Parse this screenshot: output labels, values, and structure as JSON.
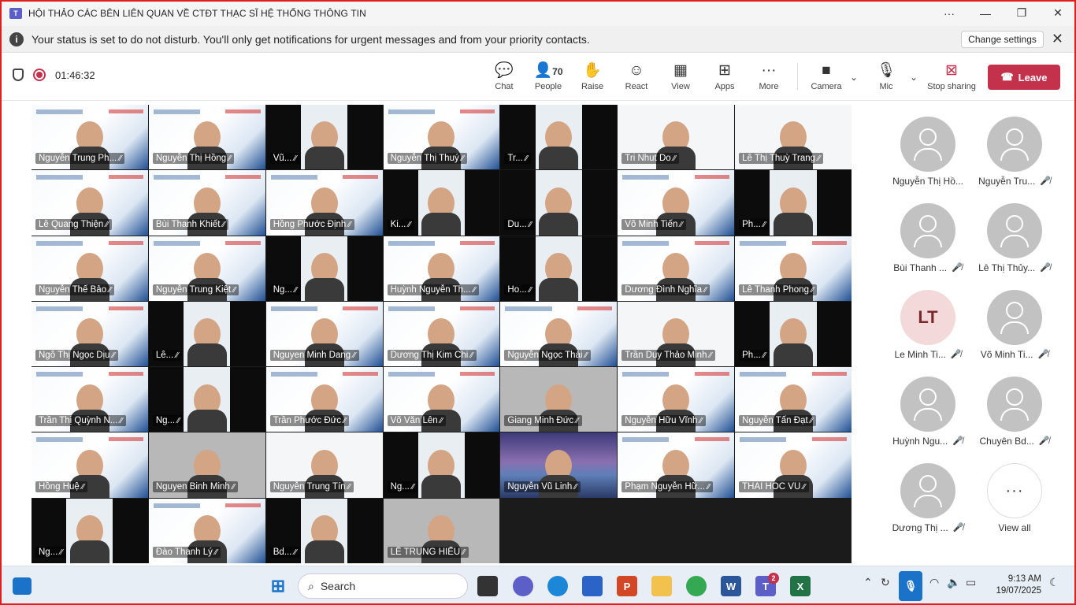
{
  "window": {
    "title": "HỘI THẢO CÁC BÊN LIÊN QUAN VỀ CTĐT THẠC SĨ HỆ THỐNG THÔNG TIN",
    "more_label": "···"
  },
  "banner": {
    "message": "Your status is set to do not disturb. You'll only get notifications for urgent messages and from your priority contacts.",
    "change_button": "Change settings"
  },
  "toolbar": {
    "timer": "01:46:32",
    "chat": "Chat",
    "people": "People",
    "people_count": "70",
    "raise": "Raise",
    "react": "React",
    "view": "View",
    "apps": "Apps",
    "more": "More",
    "camera": "Camera",
    "mic": "Mic",
    "stop_sharing": "Stop sharing",
    "leave": "Leave",
    "leave_color": "#c4314b"
  },
  "tiles": [
    {
      "name": "Nguyễn Trung  Ph...",
      "kind": "slide"
    },
    {
      "name": "Nguyễn Thị Hồng",
      "kind": "slide"
    },
    {
      "name": "Vũ...",
      "kind": "dark"
    },
    {
      "name": "Nguyễn Thị Thuý",
      "kind": "slide"
    },
    {
      "name": "Tr...",
      "kind": "dark"
    },
    {
      "name": "Tri Nhut Do",
      "kind": "light"
    },
    {
      "name": "Lê Thị Thuỳ Trang",
      "kind": "light"
    },
    {
      "name": "Lê Quang Thiện",
      "kind": "slide"
    },
    {
      "name": "Bùi Thanh Khiết",
      "kind": "slide"
    },
    {
      "name": "Hồng Phước Định",
      "kind": "slide"
    },
    {
      "name": "Ki...",
      "kind": "dark"
    },
    {
      "name": "Du...",
      "kind": "dark"
    },
    {
      "name": "Võ Minh Tiến",
      "kind": "slide"
    },
    {
      "name": "Ph...",
      "kind": "dark"
    },
    {
      "name": "Nguyễn Thế Bảo",
      "kind": "slide"
    },
    {
      "name": "Nguyễn Trung Kiệt",
      "kind": "slide"
    },
    {
      "name": "Ng...",
      "kind": "dark"
    },
    {
      "name": "Huỳnh Nguyễn Th...",
      "kind": "slide"
    },
    {
      "name": "Ho...",
      "kind": "dark"
    },
    {
      "name": "Dương Đình Nghĩa",
      "kind": "slide"
    },
    {
      "name": "Lê Thanh Phong",
      "kind": "slide"
    },
    {
      "name": "Ngô Thị Ngọc Dịu",
      "kind": "slide"
    },
    {
      "name": "Lê...",
      "kind": "dark"
    },
    {
      "name": "Nguyen Minh Dang",
      "kind": "slide"
    },
    {
      "name": "Dương Thị Kim Chi",
      "kind": "slide"
    },
    {
      "name": "Nguyễn Ngọc Thái",
      "kind": "slide"
    },
    {
      "name": "Trần Duy Thảo Minh",
      "kind": "light"
    },
    {
      "name": "Ph...",
      "kind": "dark"
    },
    {
      "name": "Trần Thị Quỳnh N...",
      "kind": "slide"
    },
    {
      "name": "Ng...",
      "kind": "dark"
    },
    {
      "name": "Trần Phước Đức",
      "kind": "slide"
    },
    {
      "name": "Võ Văn Lên",
      "kind": "slide"
    },
    {
      "name": "Giang Minh Đức",
      "kind": "gray"
    },
    {
      "name": "Nguyễn Hữu Vĩnh",
      "kind": "slide"
    },
    {
      "name": "Nguyễn Tấn Đạt",
      "kind": "slide"
    },
    {
      "name": "Hồng Huệ",
      "kind": "slide"
    },
    {
      "name": "Nguyen Binh Minh",
      "kind": "gray"
    },
    {
      "name": "Nguyễn Trung Tín",
      "kind": "light"
    },
    {
      "name": "Ng...",
      "kind": "dark"
    },
    {
      "name": "Nguyễn Vũ Linh",
      "kind": "mtn"
    },
    {
      "name": "Phạm Nguyễn Hữ...",
      "kind": "slide"
    },
    {
      "name": "THAI HOC VU",
      "kind": "slide"
    },
    {
      "name": "Ng...",
      "kind": "dark"
    },
    {
      "name": "Đào Thanh Lý",
      "kind": "slide"
    },
    {
      "name": "Bd...",
      "kind": "dark"
    },
    {
      "name": "LÊ TRUNG HIẾU",
      "kind": "gray"
    }
  ],
  "roster": [
    {
      "name": "Nguyễn Thị Hồ...",
      "muted": false,
      "initials": ""
    },
    {
      "name": "Nguyễn Tru...",
      "muted": true,
      "initials": ""
    },
    {
      "name": "Bùi Thanh ...",
      "muted": true,
      "initials": ""
    },
    {
      "name": "Lê Thị Thủy...",
      "muted": true,
      "initials": ""
    },
    {
      "name": "Le Minh Ti...",
      "muted": true,
      "initials": "LT"
    },
    {
      "name": "Võ Minh Ti...",
      "muted": true,
      "initials": ""
    },
    {
      "name": "Huỳnh Ngu...",
      "muted": true,
      "initials": ""
    },
    {
      "name": "Chuyên Bd...",
      "muted": true,
      "initials": ""
    },
    {
      "name": "Dương Thị ...",
      "muted": true,
      "initials": ""
    },
    {
      "name": "View all",
      "muted": false,
      "initials": "···"
    }
  ],
  "taskbar": {
    "search_placeholder": "Search",
    "time": "9:13 AM",
    "date": "19/07/2025",
    "teams_badge": "2"
  },
  "icons": {
    "mic_off": "mic-off-icon",
    "accent": "#5b5fc7"
  }
}
